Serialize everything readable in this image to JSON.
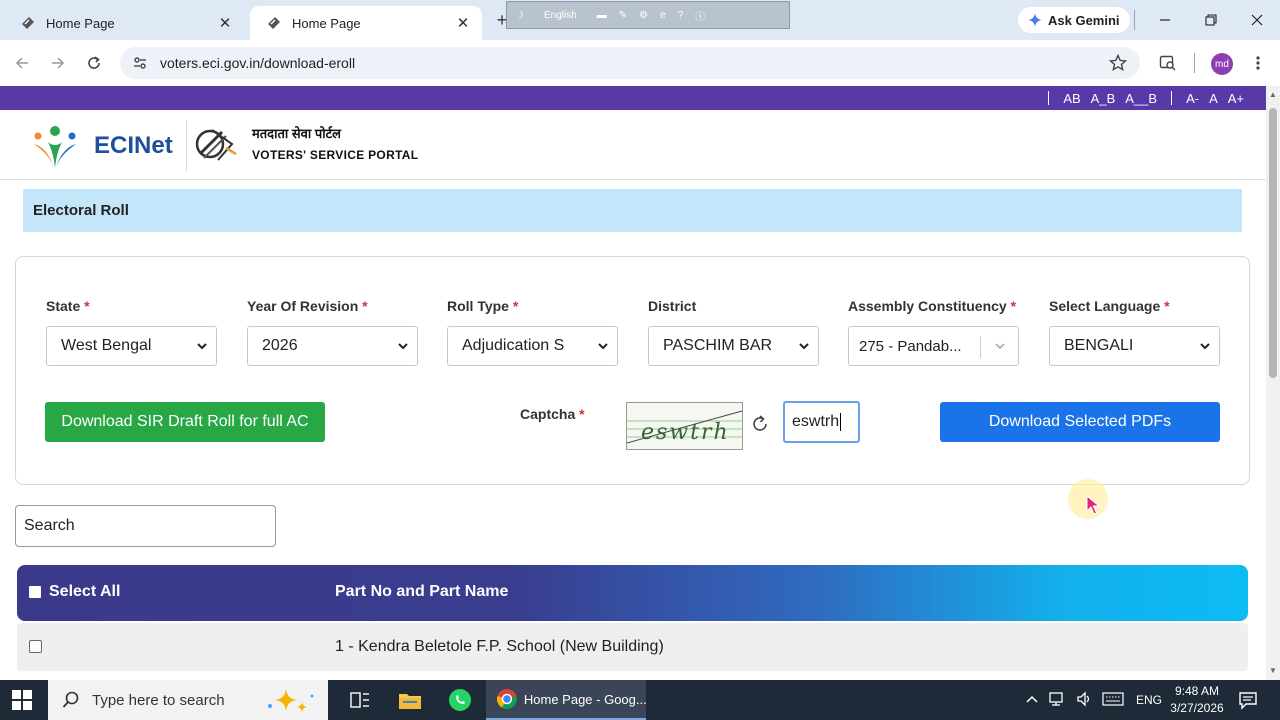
{
  "browser": {
    "tabs": [
      {
        "title": "Home Page",
        "active": false
      },
      {
        "title": "Home Page",
        "active": true
      }
    ],
    "ime_language": "English",
    "ask_gemini": "Ask Gemini",
    "url": "voters.eci.gov.in/download-eroll",
    "profile_initials": "md"
  },
  "site": {
    "text_tools": [
      "AB",
      "A_B",
      "A__B"
    ],
    "font_tools": [
      "A-",
      "A",
      "A+"
    ],
    "logo_text": "ECINet",
    "portal_hindi": "मतदाता सेवा पोर्टल",
    "portal_english": "VOTERS' SERVICE PORTAL"
  },
  "page": {
    "section_title": "Electoral Roll",
    "form": {
      "fields": [
        {
          "label": "State",
          "required": true,
          "value": "West Bengal"
        },
        {
          "label": "Year Of Revision",
          "required": true,
          "value": "2026"
        },
        {
          "label": "Roll Type",
          "required": true,
          "value": "Adjudication S"
        },
        {
          "label": "District",
          "required": false,
          "value": "PASCHIM BAR"
        },
        {
          "label": "Assembly Constituency",
          "required": true,
          "value": "275 - Pandab..."
        },
        {
          "label": "Select Language",
          "required": true,
          "value": "BENGALI"
        }
      ],
      "required_mark": "*",
      "download_full_label": "Download SIR Draft Roll for full AC",
      "captcha_label": "Captcha",
      "captcha_text": "eswtrh",
      "captcha_value": "eswtrh",
      "download_selected_label": "Download Selected PDFs"
    },
    "search_value": "Search",
    "table": {
      "select_all_label": "Select All",
      "part_column_label": "Part No and Part Name",
      "rows": [
        {
          "part": "1 - Kendra Beletole F.P. School (New Building)",
          "checked": false
        }
      ]
    }
  },
  "taskbar": {
    "search_placeholder": "Type here to search",
    "app_title": "Home Page - Goog...",
    "language": "ENG",
    "time": "9:48 AM",
    "date": "3/27/2026"
  },
  "colors": {
    "top_strip": "#5939a8",
    "section_bg": "#c3e6fa",
    "green_button": "#28a745",
    "blue_button": "#1a73e8",
    "required": "#d32f2f"
  }
}
